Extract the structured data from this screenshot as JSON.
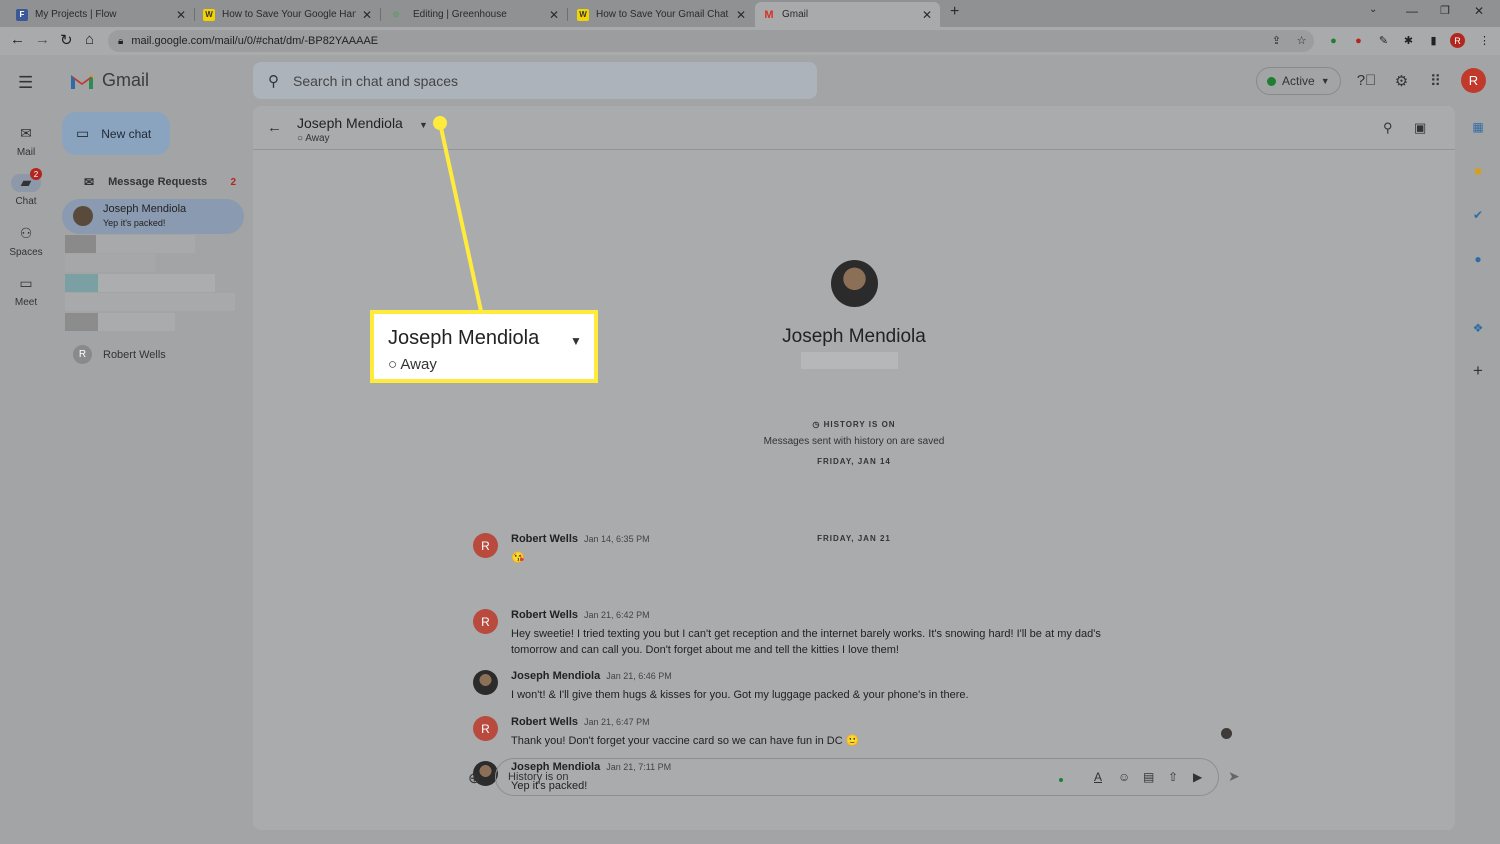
{
  "browser": {
    "tabs": [
      {
        "title": "My Projects | Flow",
        "fav_color": "#3b5998",
        "fav_glyph": "F"
      },
      {
        "title": "How to Save Your Google Hangouts",
        "fav_color": "#f1d400",
        "fav_glyph": "W"
      },
      {
        "title": "Editing | Greenhouse",
        "fav_color": "#7aa37a",
        "fav_glyph": "g"
      },
      {
        "title": "How to Save Your Gmail Chat History",
        "fav_color": "#f1d400",
        "fav_glyph": "W"
      },
      {
        "title": "Gmail",
        "fav_color": "#d93025",
        "fav_glyph": "M"
      }
    ],
    "url": "mail.google.com/mail/u/0/#chat/dm/-BP82YAAAAE",
    "profile_initial": "R"
  },
  "app": {
    "logo_text": "Gmail",
    "search_placeholder": "Search in chat and spaces",
    "status_label": "Active",
    "account_initial": "R",
    "rail": [
      {
        "label": "Mail",
        "icon": "mail-icon"
      },
      {
        "label": "Chat",
        "icon": "chat-icon",
        "badge": "2"
      },
      {
        "label": "Spaces",
        "icon": "spaces-icon"
      },
      {
        "label": "Meet",
        "icon": "meet-icon"
      }
    ]
  },
  "sidebar": {
    "new_chat": "New chat",
    "message_requests": "Message Requests",
    "message_requests_count": "2",
    "active_conversation": {
      "name": "Joseph Mendiola",
      "preview": "Yep it's packed!"
    },
    "other_contact": {
      "name": "Robert Wells",
      "initial": "R"
    }
  },
  "conversation": {
    "name": "Joseph Mendiola",
    "status": "Away",
    "history_title": "HISTORY IS ON",
    "history_sub": "Messages sent with history on are saved",
    "day1": "FRIDAY, JAN 14",
    "day2": "FRIDAY, JAN 21",
    "messages": [
      {
        "sender": "Robert Wells",
        "time": "Jan 14, 6:35 PM",
        "text": "😘",
        "initial": "R"
      },
      {
        "sender": "Robert Wells",
        "time": "Jan 21, 6:42 PM",
        "text": "Hey sweetie! I tried texting you but I can't get reception and the internet barely works. It's snowing hard! I'll be at my dad's tomorrow and can call you. Don't forget about me and tell the kitties I love them!",
        "initial": "R"
      },
      {
        "sender": "Joseph Mendiola",
        "time": "Jan 21, 6:46 PM",
        "text": "I won't! & I'll give them hugs & kisses for you. Got my luggage packed & your phone's in there."
      },
      {
        "sender": "Robert Wells",
        "time": "Jan 21, 6:47 PM",
        "text": "Thank you! Don't forget your vaccine card so we can have fun in DC 🙂",
        "initial": "R"
      },
      {
        "sender": "Joseph Mendiola",
        "time": "Jan 21, 7:11 PM",
        "text": "Yep it's packed!"
      }
    ],
    "composer_placeholder": "History is on"
  },
  "callout": {
    "name": "Joseph Mendiola",
    "status": "Away",
    "color": "#ffeb3b"
  }
}
